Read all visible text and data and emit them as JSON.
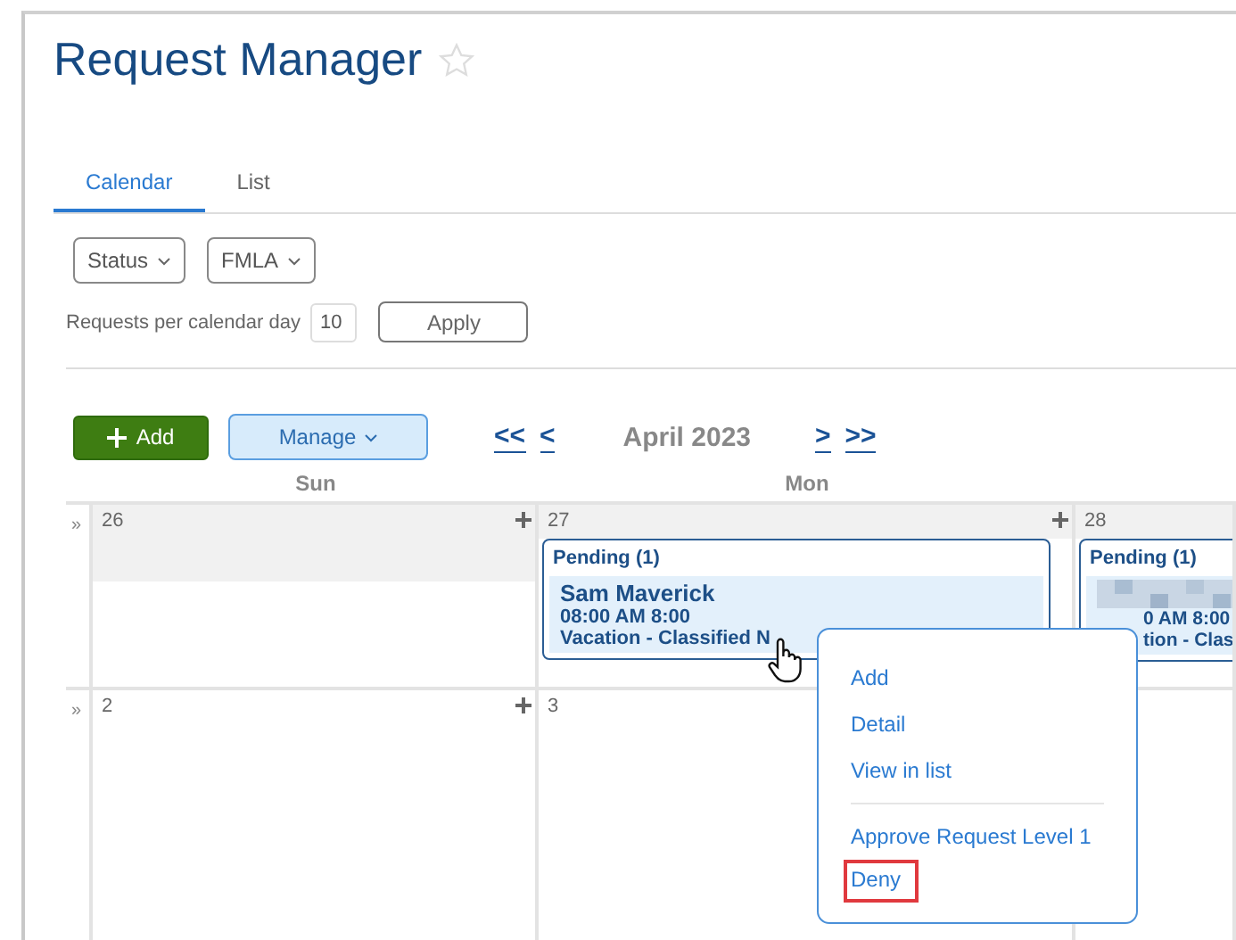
{
  "title": "Request Manager",
  "starred": false,
  "tabs": [
    {
      "label": "Calendar",
      "selected": true
    },
    {
      "label": "List",
      "selected": false
    }
  ],
  "filters": [
    "Status",
    "FMLA"
  ],
  "per_day": {
    "label": "Requests per calendar day",
    "value": "10"
  },
  "apply": "Apply",
  "toolbar": {
    "add": "Add",
    "manage": "Manage"
  },
  "nav": {
    "first": "<<",
    "prev": "<",
    "month": "April 2023",
    "next": ">",
    "last": ">>"
  },
  "days": [
    "Sun",
    "Mon"
  ],
  "weeks": [
    {
      "marker": "»",
      "cells": [
        {
          "date": "26",
          "other_month": true,
          "add": true
        },
        {
          "date": "27",
          "other_month": true,
          "add": true,
          "event": {
            "status": "Pending (1)",
            "entries": [
              {
                "name": "Sam Maverick",
                "time": "08:00 AM 8:00",
                "type": "Vacation - Classified N",
                "covered": false
              }
            ]
          }
        },
        {
          "date": "28",
          "other_month": true,
          "event": {
            "status": "Pending (1)",
            "entries": [
              {
                "name_hidden": true,
                "time": "0 AM 8:00",
                "type": "tion - Clas",
                "covered": true
              }
            ]
          }
        }
      ]
    },
    {
      "marker": "»",
      "cells": [
        {
          "date": "2",
          "other_month": false,
          "add": true
        },
        {
          "date": "3",
          "other_month": false
        }
      ]
    }
  ],
  "context_menu": {
    "groups": [
      [
        {
          "label": "Add",
          "highlighted": false
        },
        {
          "label": "Detail",
          "highlighted": false
        },
        {
          "label": "View in list",
          "highlighted": false
        }
      ],
      [
        {
          "label": "Approve Request Level 1",
          "highlighted": false
        },
        {
          "label": "Deny",
          "highlighted": true
        }
      ]
    ]
  }
}
